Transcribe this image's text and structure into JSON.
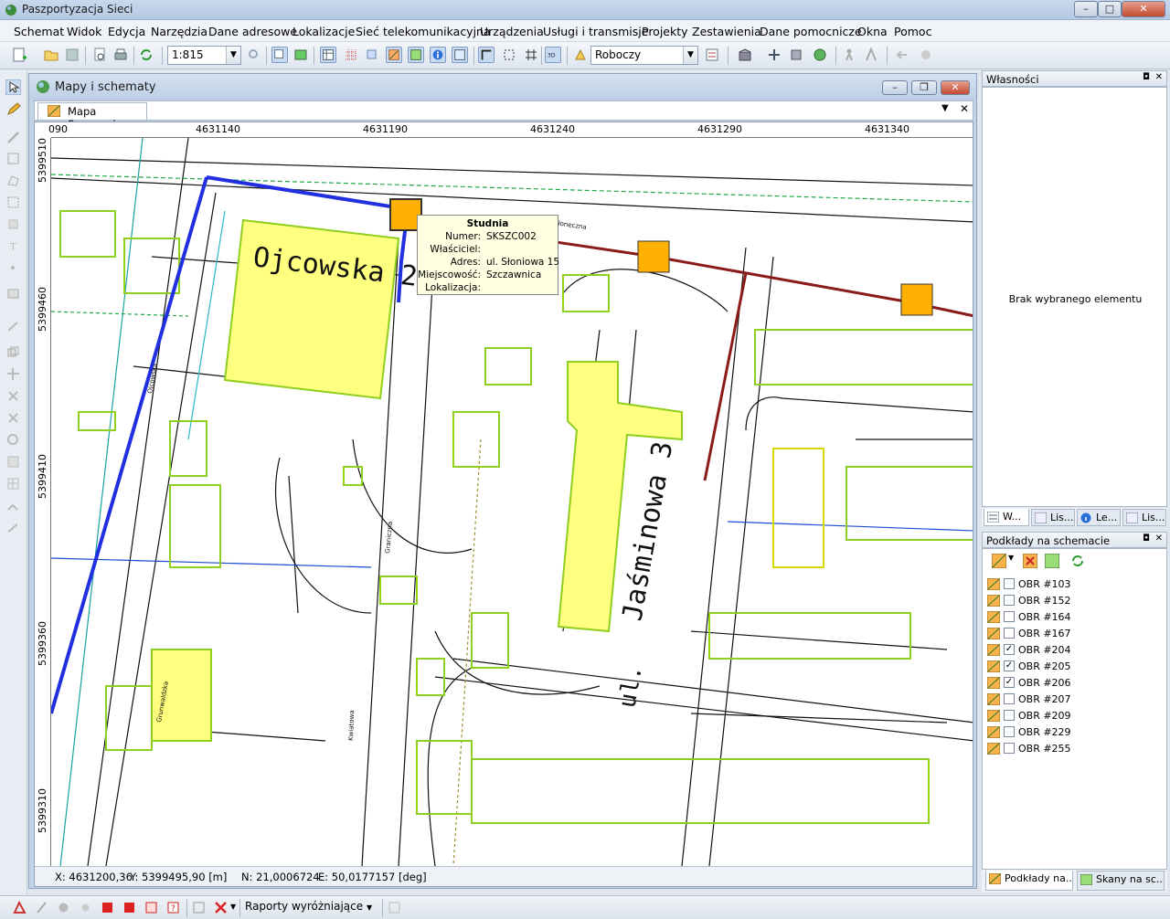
{
  "window": {
    "title": "Paszportyzacja Sieci"
  },
  "menu": [
    "Schemat",
    "Widok",
    "Edycja",
    "Narzędzia",
    "Dane adresowe",
    "Lokalizacje",
    "Sieć telekomunikacyjna",
    "Urządzenia",
    "Usługi i transmisje",
    "Projekty",
    "Zestawienia",
    "Dane pomocnicze",
    "Okna",
    "Pomoc"
  ],
  "toolbar": {
    "scale": "1:815",
    "workspace": "Roboczy"
  },
  "mdi": {
    "title": "Mapy i schematy",
    "tab": "Mapa Szczawnica"
  },
  "rulers": {
    "x_labels": [
      "090",
      "4631140",
      "4631190",
      "4631240",
      "4631290",
      "4631340"
    ],
    "y_labels": [
      "5399510",
      "5399460",
      "5399410",
      "5399360",
      "5399310"
    ]
  },
  "map": {
    "street_labels": [
      "Ojcowska 2",
      "Jaśminowa 3",
      "Słoneczna",
      "Ojcowska",
      "Graniczna",
      "Kwiatowa",
      "Grunwaldzka",
      "ul."
    ]
  },
  "tooltip": {
    "title": "Studnia",
    "rows": [
      {
        "key": "Numer:",
        "value": "SKSZC002"
      },
      {
        "key": "Właściciel:",
        "value": ""
      },
      {
        "key": "Adres:",
        "value": "ul. Słoniowa 15"
      },
      {
        "key": "Miejscowość:",
        "value": "Szczawnica"
      },
      {
        "key": "Lokalizacja:",
        "value": ""
      }
    ]
  },
  "status": {
    "x": "X: 4631200,36",
    "y": "Y: 5399495,90 [m]",
    "n": "N: 21,0006724",
    "e": "E: 50,0177157 [deg]"
  },
  "properties": {
    "title": "Własności",
    "empty_text": "Brak wybranego elementu",
    "tabs": [
      "W...",
      "Lis...",
      "Le...",
      "Lis..."
    ]
  },
  "layers": {
    "title": "Podkłady na schemacie",
    "items": [
      {
        "name": "OBR #103",
        "checked": false
      },
      {
        "name": "OBR #152",
        "checked": false
      },
      {
        "name": "OBR #164",
        "checked": false
      },
      {
        "name": "OBR #167",
        "checked": false
      },
      {
        "name": "OBR #204",
        "checked": true
      },
      {
        "name": "OBR #205",
        "checked": true
      },
      {
        "name": "OBR #206",
        "checked": true
      },
      {
        "name": "OBR #207",
        "checked": false
      },
      {
        "name": "OBR #209",
        "checked": false
      },
      {
        "name": "OBR #229",
        "checked": false
      },
      {
        "name": "OBR #255",
        "checked": false
      }
    ],
    "tabs": [
      "Podkłady na...",
      "Skany na sc..."
    ]
  },
  "bottom": {
    "reports": "Raporty wyróżniające"
  },
  "colors": {
    "building": "#ffff80",
    "outline": "#8fcf1e",
    "duct": "#2030e0",
    "cable": "#8b1a1a",
    "well": "#ffb000"
  }
}
